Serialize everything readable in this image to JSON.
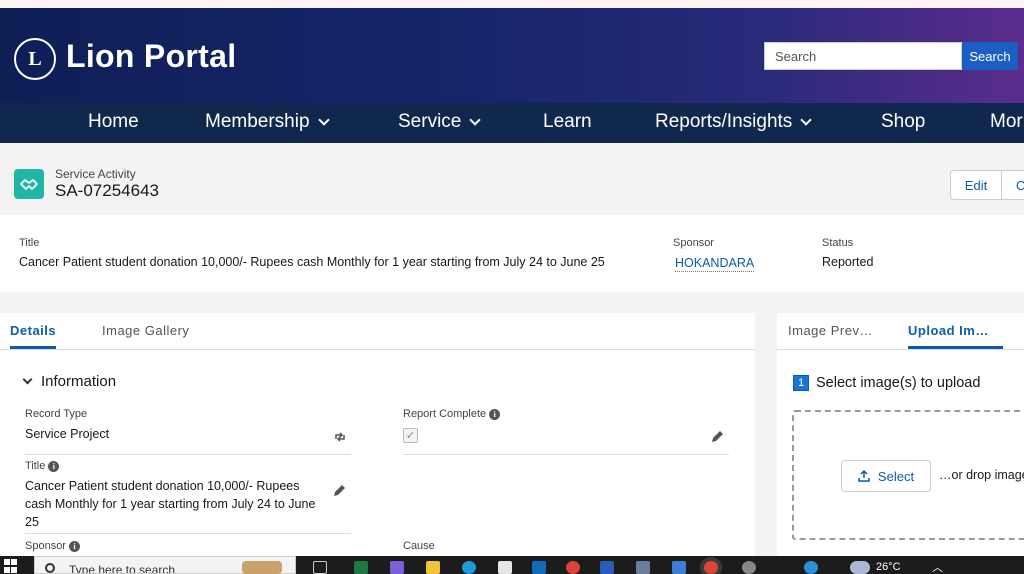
{
  "header": {
    "brand": "Lion Portal",
    "logo_text": "L",
    "search_placeholder": "Search",
    "search_button": "Search"
  },
  "nav": {
    "items": [
      {
        "label": "Home",
        "dropdown": false
      },
      {
        "label": "Membership",
        "dropdown": true
      },
      {
        "label": "Service",
        "dropdown": true
      },
      {
        "label": "Learn",
        "dropdown": false
      },
      {
        "label": "Reports/Insights",
        "dropdown": true
      },
      {
        "label": "Shop",
        "dropdown": false
      },
      {
        "label": "Mor",
        "dropdown": false
      }
    ]
  },
  "record": {
    "type_label": "Service Activity",
    "id": "SA-07254643",
    "edit_button": "Edit",
    "second_button": "C"
  },
  "highlights": {
    "title_label": "Title",
    "title_value": "Cancer Patient student donation 10,000/- Rupees cash Monthly for 1 year starting from July 24 to June 25",
    "sponsor_label": "Sponsor",
    "sponsor_value": "HOKANDARA",
    "status_label": "Status",
    "status_value": "Reported"
  },
  "left_tabs": [
    {
      "label": "Details",
      "active": true
    },
    {
      "label": "Image Gallery",
      "active": false
    }
  ],
  "details": {
    "section_title": "Information",
    "record_type_label": "Record Type",
    "record_type_value": "Service Project",
    "report_complete_label": "Report Complete",
    "report_complete_checked": true,
    "title_label": "Title",
    "title_value": "Cancer Patient student donation 10,000/- Rupees cash Monthly for 1 year starting from July 24 to June 25",
    "sponsor_label": "Sponsor",
    "cause_label": "Cause"
  },
  "right_tabs": [
    {
      "label": "Image Prev…",
      "active": false
    },
    {
      "label": "Upload Im…",
      "active": true
    }
  ],
  "upload": {
    "step_number": "1",
    "step_label": "Select image(s) to upload",
    "select_button": "Select",
    "drop_text": "…or drop image"
  },
  "taskbar": {
    "search_placeholder": "Type here to search",
    "weather": "26°C"
  },
  "colors": {
    "header_start": "#0e1f56",
    "header_end": "#5b2d8c",
    "nav_bg": "#11284e",
    "accent": "#0b5cab",
    "record_icon": "#1fb6a8"
  }
}
